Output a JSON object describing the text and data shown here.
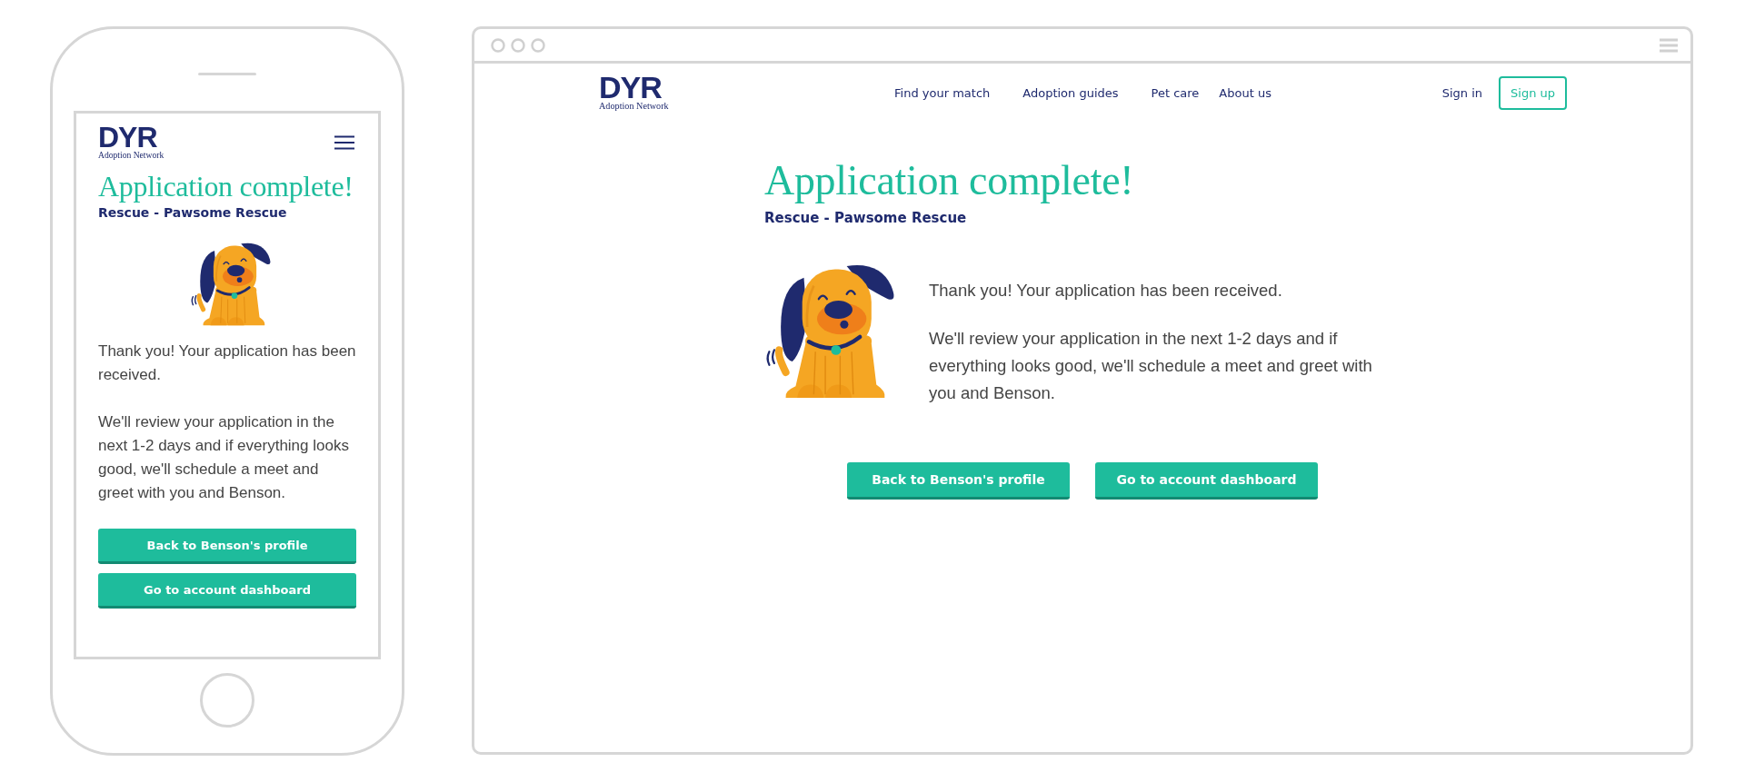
{
  "phone": {
    "logo": {
      "mark": "DYR",
      "tagline": "Adoption Network"
    },
    "title": "Application complete!",
    "subtitle": "Rescue - Pawsome Rescue",
    "paragraphs": [
      "Thank you! Your application has been received.",
      "We'll review your application in the next 1-2 days and if everything looks good, we'll schedule a meet and greet with you and Benson."
    ],
    "buttons": [
      "Back to Benson's profile",
      "Go to account dashboard"
    ]
  },
  "browser": {
    "logo": {
      "mark": "DYR",
      "tagline": "Adoption Network"
    },
    "nav": [
      "Find your match",
      "Adoption guides",
      "Pet care",
      "About us"
    ],
    "sign_in": "Sign in",
    "sign_up": "Sign up",
    "title": "Application complete!",
    "subtitle": "Rescue - Pawsome Rescue",
    "paragraphs": [
      "Thank you! Your application has been received.",
      "We'll review your application in the next 1-2 days and if everything looks good, we'll schedule a meet and greet with you and Benson."
    ],
    "buttons": [
      "Back to Benson's profile",
      "Go to account dashboard"
    ]
  }
}
